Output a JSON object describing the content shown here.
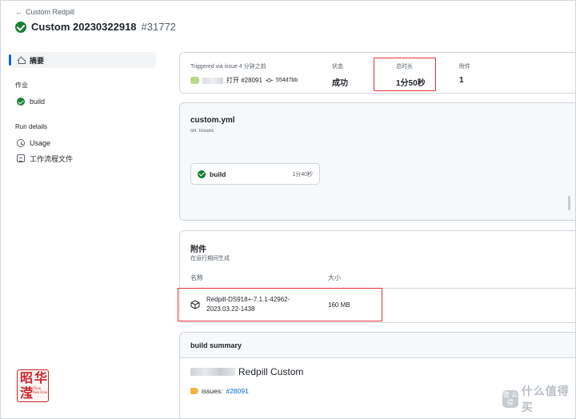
{
  "header": {
    "back_label": "Custom Redpill",
    "title": "Custom 20230322918",
    "run_number": "#31772"
  },
  "sidebar": {
    "summary_label": "摘要",
    "jobs_heading": "作业",
    "job_item_label": "build",
    "run_details_heading": "Run details",
    "usage_label": "Usage",
    "workflow_file_label": "工作流程文件"
  },
  "run_summary": {
    "trigger_text": "Triggered via issue 4 分钟之前",
    "trigger_action": "打开 #28091",
    "commit_sha": "554d7bb",
    "status_label": "状态",
    "status_value": "成功",
    "duration_label": "总时长",
    "duration_value": "1分50秒",
    "artifacts_label": "附件",
    "artifacts_count": "1"
  },
  "workflow": {
    "file_name": "custom.yml",
    "trigger": "on: issues",
    "job_name": "build",
    "job_duration": "1分40秒"
  },
  "artifacts": {
    "title": "附件",
    "subtitle": "在运行期间生成",
    "name_header": "名称",
    "size_header": "大小",
    "item_name": "Redpill-DS918+-7.1.1-42962-2023.03.22-1438",
    "item_size": "160 MB"
  },
  "build_summary": {
    "heading": "build summary",
    "title": "Redpill Custom",
    "issues_label": "issues:",
    "issues_link": "#28091"
  },
  "watermark": {
    "badge": "值 么得",
    "site": "什么值得买"
  },
  "seal": {
    "chars": [
      "昭",
      "华",
      "滢"
    ],
    "small_text": "Zhao Hua Diao"
  },
  "colors": {
    "success": "#1a7f37",
    "highlight": "#e5323b",
    "link": "#0969da"
  }
}
